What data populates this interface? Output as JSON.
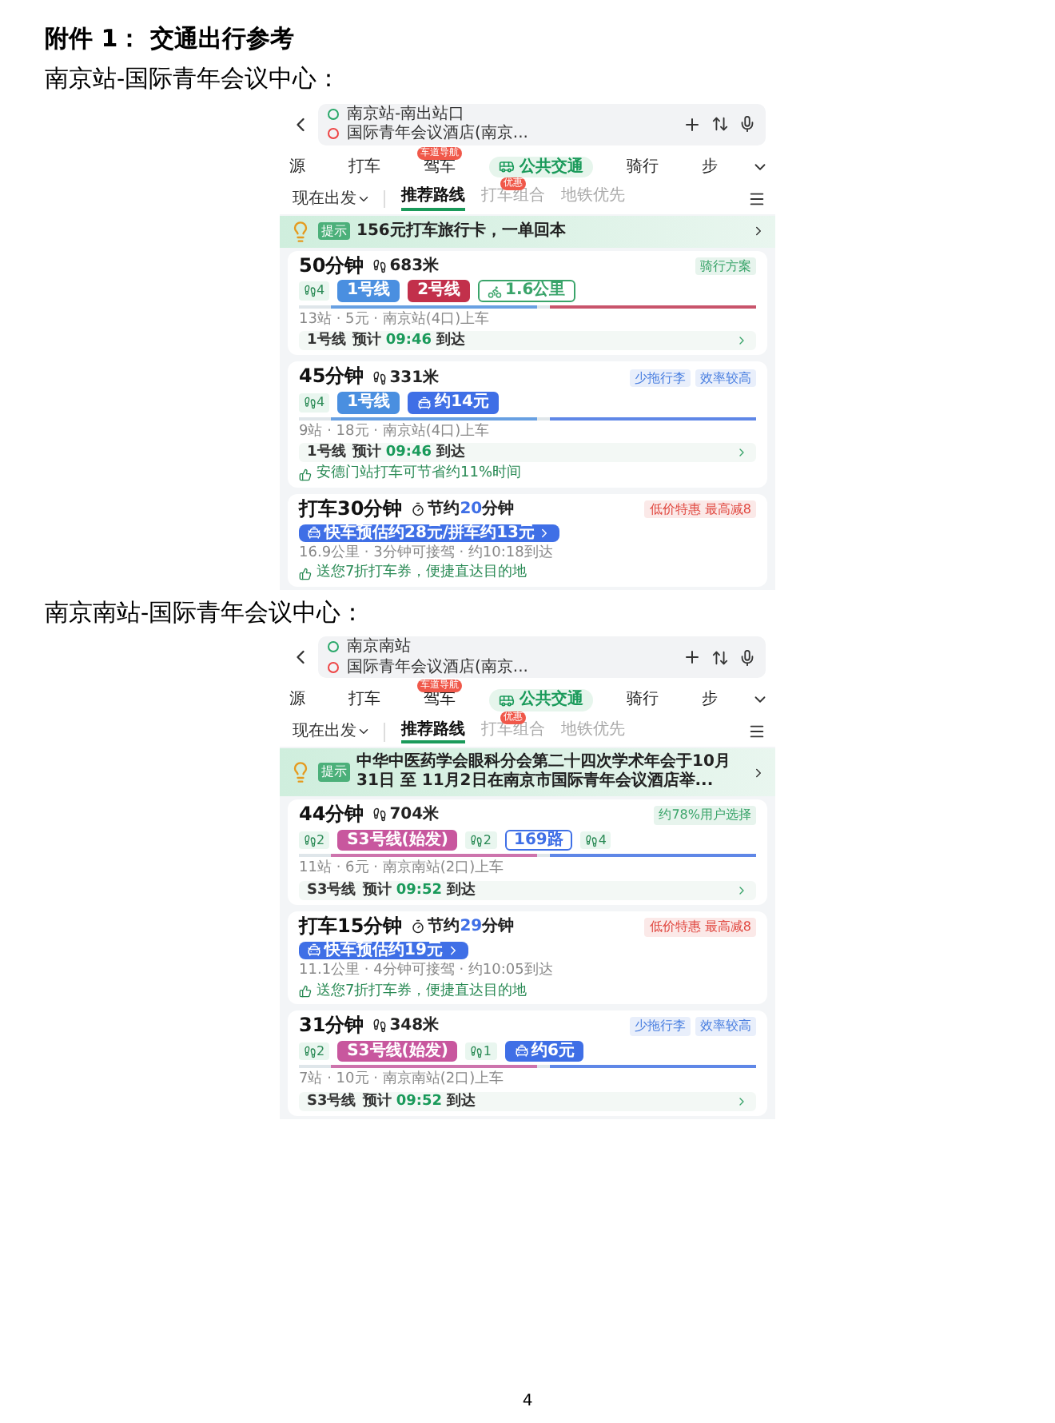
{
  "heading": "附件 1：  交通出行参考",
  "sections": [
    {
      "caption": "南京站-国际青年会议中心：",
      "screen": {
        "from": "南京站-南出站口",
        "to": "国际青年会议酒店(南京...",
        "modes": [
          {
            "label": "源",
            "selected": false
          },
          {
            "label": "打车",
            "selected": false
          },
          {
            "label": "驾车",
            "selected": false,
            "badge": "车道导航"
          },
          {
            "label": "公共交通",
            "selected": true
          },
          {
            "label": "骑行",
            "selected": false
          },
          {
            "label": "步",
            "selected": false
          }
        ],
        "depart": "现在出发",
        "sorts": [
          {
            "label": "推荐路线",
            "selected": true
          },
          {
            "label": "打车组合",
            "selected": false,
            "badge": "优惠"
          },
          {
            "label": "地铁优先",
            "selected": false
          }
        ],
        "tip": {
          "label": "提示",
          "text": "156元打车旅行卡，一单回本"
        },
        "routes": [
          {
            "kind": "transit",
            "title": "50分钟",
            "walk": "683米",
            "tags": [
              {
                "text": "骑行方案",
                "color": "#3aa46a"
              }
            ],
            "segments": [
              {
                "kind": "walk",
                "text": "4"
              },
              {
                "kind": "line",
                "text": "1号线",
                "color": "#4a8fe0"
              },
              {
                "kind": "line",
                "text": "2号线",
                "color": "#c2304b"
              },
              {
                "kind": "bike",
                "text": "1.6公里"
              }
            ],
            "info": "13站 · 5元 · 南京站(4口)上车",
            "eta": {
              "line": "1号线",
              "label": "预计",
              "time": "09:46",
              "suffix": "到达"
            }
          },
          {
            "kind": "transit",
            "title": "45分钟",
            "walk": "331米",
            "tags": [
              {
                "text": "少拖行李",
                "color": "#4a7fe0"
              },
              {
                "text": "效率较高",
                "color": "#4a7fe0"
              }
            ],
            "segments": [
              {
                "kind": "walk",
                "text": "4"
              },
              {
                "kind": "line",
                "text": "1号线",
                "color": "#4a8fe0"
              },
              {
                "kind": "taxi",
                "text": "约14元",
                "color": "#3f6fe6"
              }
            ],
            "info": "9站 · 18元 · 南京站(4口)上车",
            "eta": {
              "line": "1号线",
              "label": "预计",
              "time": "09:46",
              "suffix": "到达"
            },
            "note": "安德门站打车可节省约11%时间"
          },
          {
            "kind": "taxi",
            "title": "打车30分钟",
            "save": {
              "pre": "节约",
              "num": "20",
              "post": "分钟"
            },
            "tags": [
              {
                "text": "低价特惠 最高减8",
                "color": "#e0463e"
              }
            ],
            "fare": "快车预估约28元/拼车约13元",
            "info": "16.9公里 · 3分钟可接驾 · 约10:18到达",
            "note": "送您7折打车券，便捷直达目的地"
          }
        ]
      }
    },
    {
      "caption": "南京南站-国际青年会议中心：",
      "screen": {
        "from": "南京南站",
        "to": "国际青年会议酒店(南京...",
        "modes": [
          {
            "label": "源",
            "selected": false
          },
          {
            "label": "打车",
            "selected": false
          },
          {
            "label": "驾车",
            "selected": false,
            "badge": "车道导航"
          },
          {
            "label": "公共交通",
            "selected": true
          },
          {
            "label": "骑行",
            "selected": false
          },
          {
            "label": "步",
            "selected": false
          }
        ],
        "depart": "现在出发",
        "sorts": [
          {
            "label": "推荐路线",
            "selected": true
          },
          {
            "label": "打车组合",
            "selected": false,
            "badge": "优惠"
          },
          {
            "label": "地铁优先",
            "selected": false
          }
        ],
        "tip": {
          "label": "提示",
          "text": "中华中医药学会眼科分会第二十四次学术年会于10月31日 至 11月2日在南京市国际青年会议酒店举..."
        },
        "routes": [
          {
            "kind": "transit",
            "title": "44分钟",
            "walk": "704米",
            "tags": [
              {
                "text": "约78%用户选择",
                "color": "#3aa46a"
              }
            ],
            "segments": [
              {
                "kind": "walk",
                "text": "2"
              },
              {
                "kind": "line",
                "text": "S3号线(始发)",
                "color": "#c8579e"
              },
              {
                "kind": "walk",
                "text": "2"
              },
              {
                "kind": "outline",
                "text": "169路",
                "color": "#3f6fe6"
              },
              {
                "kind": "walk",
                "text": "4"
              }
            ],
            "info": "11站 · 6元 · 南京南站(2口)上车",
            "eta": {
              "line": "S3号线",
              "label": "预计",
              "time": "09:52",
              "suffix": "到达"
            }
          },
          {
            "kind": "taxi",
            "title": "打车15分钟",
            "save": {
              "pre": "节约",
              "num": "29",
              "post": "分钟"
            },
            "tags": [
              {
                "text": "低价特惠 最高减8",
                "color": "#e0463e"
              }
            ],
            "fare": "快车预估约19元",
            "info": "11.1公里 · 4分钟可接驾 · 约10:05到达",
            "note": "送您7折打车券，便捷直达目的地"
          },
          {
            "kind": "transit",
            "title": "31分钟",
            "walk": "348米",
            "tags": [
              {
                "text": "少拖行李",
                "color": "#4a7fe0"
              },
              {
                "text": "效率较高",
                "color": "#4a7fe0"
              }
            ],
            "segments": [
              {
                "kind": "walk",
                "text": "2"
              },
              {
                "kind": "line",
                "text": "S3号线(始发)",
                "color": "#c8579e"
              },
              {
                "kind": "walk",
                "text": "1"
              },
              {
                "kind": "taxi",
                "text": "约6元",
                "color": "#3f6fe6"
              }
            ],
            "info": "7站 · 10元 · 南京南站(2口)上车",
            "eta": {
              "line": "S3号线",
              "label": "预计",
              "time": "09:52",
              "suffix": "到达"
            }
          }
        ]
      }
    }
  ],
  "page_number": "4"
}
